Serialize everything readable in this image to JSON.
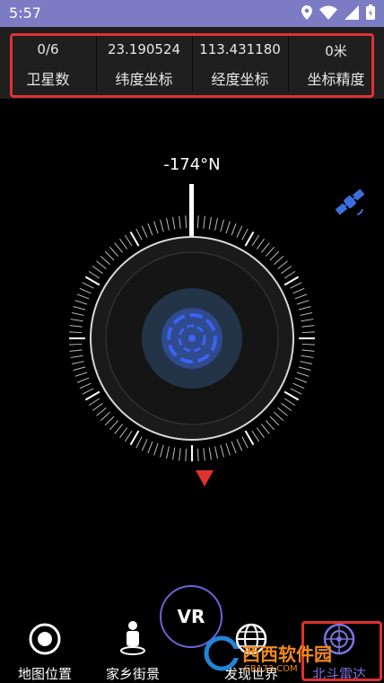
{
  "status": {
    "time": "5:57"
  },
  "stats": [
    {
      "value": "0/6",
      "label": "卫星数"
    },
    {
      "value": "23.190524",
      "label": "纬度坐标"
    },
    {
      "value": "113.431180",
      "label": "经度坐标"
    },
    {
      "value": "0米",
      "label": "坐标精度"
    }
  ],
  "compass": {
    "heading": "-174°N"
  },
  "nav": {
    "vr": "VR",
    "tabs": [
      {
        "label": "地图位置",
        "icon": "record-icon"
      },
      {
        "label": "家乡街景",
        "icon": "person-icon"
      },
      {
        "label": "发现世界",
        "icon": "globe-icon"
      },
      {
        "label": "北斗雷达",
        "icon": "radar-icon"
      }
    ]
  },
  "watermark": {
    "brand": "西西软件园",
    "url": "CR173.COM"
  },
  "colors": {
    "accent": "#6c63d8",
    "status_bar": "#7c7cc4",
    "highlight": "#e03030",
    "pointer": "#e0332b"
  }
}
